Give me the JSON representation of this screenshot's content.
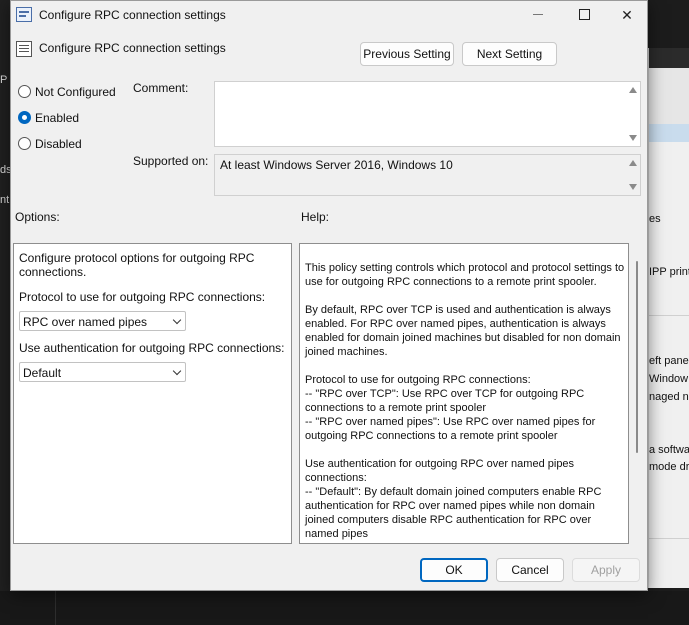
{
  "window": {
    "title": "Configure RPC connection settings",
    "minimize_glyph": "",
    "close_glyph": "✕"
  },
  "header": {
    "title": "Configure RPC connection settings",
    "prev_label": "Previous Setting",
    "next_label": "Next Setting"
  },
  "state": {
    "options": [
      "Not Configured",
      "Enabled",
      "Disabled"
    ],
    "selected": "Enabled"
  },
  "comment": {
    "label": "Comment:",
    "value": ""
  },
  "supported": {
    "label": "Supported on:",
    "value": "At least Windows Server 2016, Windows 10"
  },
  "options_pane": {
    "label": "Options:",
    "intro": "Configure protocol options for outgoing RPC connections.",
    "protocol_label": "Protocol to use for outgoing RPC connections:",
    "protocol_value": "RPC over named pipes",
    "auth_label": "Use authentication for outgoing RPC connections:",
    "auth_value": "Default"
  },
  "help_pane": {
    "label": "Help:",
    "paragraphs": [
      "This policy setting controls which protocol and protocol settings to use for outgoing RPC connections to a remote print spooler.",
      "By default, RPC over TCP is used and authentication is always enabled. For RPC over named pipes, authentication is always enabled for domain joined machines but disabled for non domain joined machines.",
      "Protocol to use for outgoing RPC connections:\n    -- \"RPC over TCP\": Use RPC over TCP for outgoing RPC connections to a remote print spooler\n    -- \"RPC over named pipes\": Use RPC over named pipes for outgoing RPC connections to a remote print spooler",
      "Use authentication for outgoing RPC over named pipes connections:\n    -- \"Default\": By default domain joined computers enable RPC authentication for RPC over named pipes while non domain joined computers disable RPC authentication for RPC over named pipes"
    ]
  },
  "footer": {
    "ok": "OK",
    "cancel": "Cancel",
    "apply": "Apply"
  },
  "background": {
    "left_snippets": [
      "P",
      "ds",
      "nt"
    ],
    "right_snippets": [
      "es",
      "IPP print",
      "eft pane",
      "Window",
      "naged ne",
      "a softwar",
      "mode dr"
    ]
  },
  "colors": {
    "accent": "#0067c0",
    "dialog_bg": "#f0f0f0"
  }
}
